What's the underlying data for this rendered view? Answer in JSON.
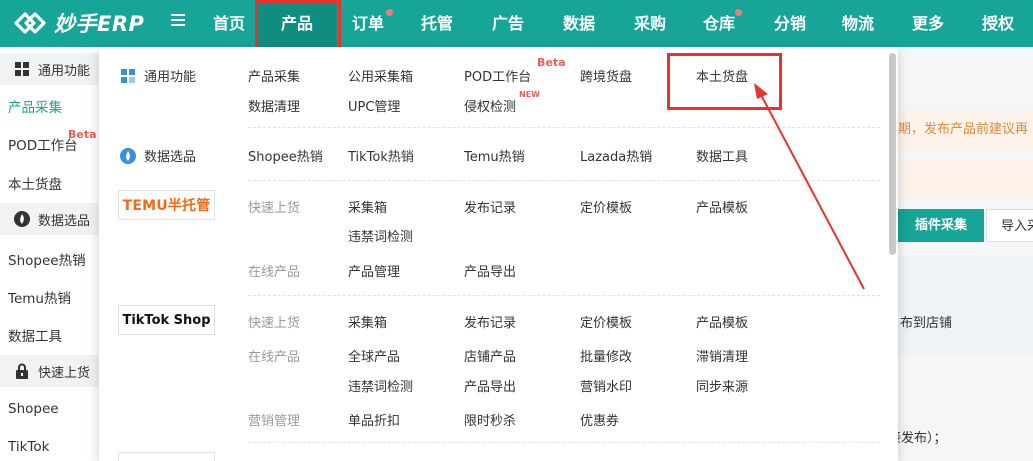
{
  "brand": {
    "logo_text": "妙手ERP"
  },
  "nav": {
    "items": [
      {
        "label": "首页"
      },
      {
        "label": "产品"
      },
      {
        "label": "订单",
        "dot": true
      },
      {
        "label": "托管"
      },
      {
        "label": "广告"
      },
      {
        "label": "数据"
      },
      {
        "label": "采购"
      },
      {
        "label": "仓库",
        "dot": true
      },
      {
        "label": "分销"
      },
      {
        "label": "物流"
      },
      {
        "label": "更多"
      },
      {
        "label": "授权"
      }
    ]
  },
  "sidebar": {
    "groups": [
      {
        "label": "通用功能",
        "icon": "grid-icon"
      },
      {
        "label": "数据选品",
        "icon": "flame-icon"
      },
      {
        "label": "快速上货",
        "icon": "lock-icon"
      }
    ],
    "items": [
      "产品采集",
      "POD工作台",
      "本土货盘",
      "Shopee热销",
      "Temu热销",
      "数据工具",
      "Shopee",
      "TikTok"
    ],
    "beta": "Beta"
  },
  "background": {
    "notice": "期，发布产品前建议再",
    "tab_plugin": "插件采集",
    "tab_import": "导入采",
    "shop_text": "布到店铺",
    "publish_text": "接发布）；"
  },
  "dropdown": {
    "general": {
      "title": "通用功能",
      "links": [
        "产品采集",
        "公用采集箱",
        "POD工作台",
        "跨境货盘",
        "本土货盘",
        "数据清理",
        "UPC管理",
        "侵权检测"
      ],
      "beta": "Beta",
      "new": "NEW"
    },
    "data": {
      "title": "数据选品",
      "links": [
        "Shopee热销",
        "TikTok热销",
        "Temu热销",
        "Lazada热销",
        "数据工具"
      ]
    },
    "temu": {
      "logo": "TEMU半托管",
      "quick_label": "快速上货",
      "quick_links": [
        "采集箱",
        "发布记录",
        "定价模板",
        "产品模板",
        "违禁词检测"
      ],
      "online_label": "在线产品",
      "online_links": [
        "产品管理",
        "产品导出"
      ]
    },
    "tiktok": {
      "logo": "TikTok Shop",
      "quick_label": "快速上货",
      "quick_links": [
        "采集箱",
        "发布记录",
        "定价模板",
        "产品模板"
      ],
      "online_label": "在线产品",
      "online_links": [
        "全球产品",
        "店铺产品",
        "批量修改",
        "滞销清理",
        "违禁词检测",
        "产品导出",
        "营销水印",
        "同步来源"
      ],
      "marketing_label": "营销管理",
      "marketing_links": [
        "单品折扣",
        "限时秒杀",
        "优惠券"
      ]
    }
  },
  "colors": {
    "brand_teal": "#16a596",
    "active_nav": "#0f8d80",
    "highlight_red": "#e8322d",
    "temu_orange": "#f26a14"
  }
}
